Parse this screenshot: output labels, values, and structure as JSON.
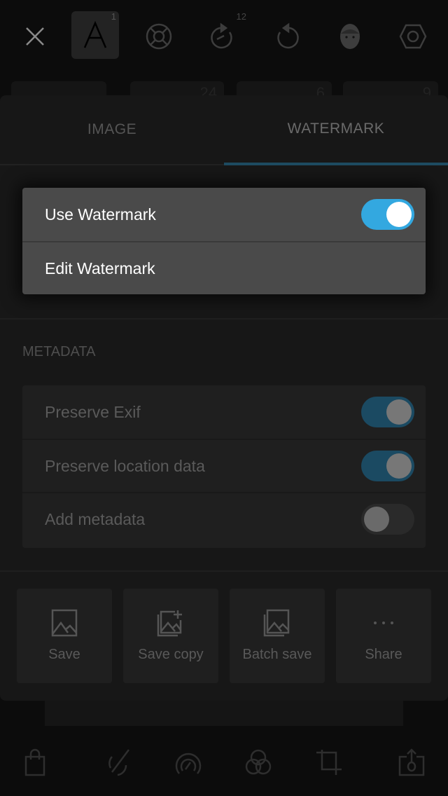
{
  "toolbar": {
    "items": [
      {
        "icon": "close-icon"
      },
      {
        "icon": "text-icon",
        "badge": "1",
        "active": true
      },
      {
        "icon": "lifebuoy-icon"
      },
      {
        "icon": "redo-timer-icon",
        "badge": "12"
      },
      {
        "icon": "undo-icon"
      },
      {
        "icon": "face-icon"
      },
      {
        "icon": "hexagon-icon"
      }
    ]
  },
  "background_cards": [
    "24",
    "6",
    "9"
  ],
  "tabs": [
    {
      "label": "IMAGE",
      "selected": false
    },
    {
      "label": "WATERMARK",
      "selected": true
    }
  ],
  "watermark": {
    "use_label": "Use Watermark",
    "use_on": true,
    "edit_label": "Edit Watermark"
  },
  "metadata": {
    "title": "METADATA",
    "items": [
      {
        "label": "Preserve Exif",
        "on": true
      },
      {
        "label": "Preserve location data",
        "on": true
      },
      {
        "label": "Add metadata",
        "on": false
      }
    ]
  },
  "actions": [
    {
      "label": "Save",
      "icon": "image-icon"
    },
    {
      "label": "Save copy",
      "icon": "image-copy-add-icon"
    },
    {
      "label": "Batch save",
      "icon": "image-stack-icon"
    },
    {
      "label": "Share",
      "icon": "more-dots-icon"
    }
  ],
  "bottombar": [
    "bag-icon",
    "brush-icon",
    "gauge-icon",
    "color-circles-icon",
    "crop-icon",
    "export-icon"
  ],
  "colors": {
    "accent": "#33a8e0",
    "accent_dim": "#1b4a62",
    "panel": "#171717"
  }
}
